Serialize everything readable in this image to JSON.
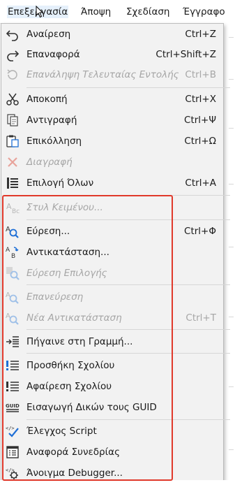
{
  "menubar": {
    "items": [
      {
        "label": "Επεξεργασία"
      },
      {
        "label": "Άποψη"
      },
      {
        "label": "Σχεδίαση"
      },
      {
        "label": "Έγγραφο"
      }
    ]
  },
  "menu": {
    "items": [
      {
        "label": "Αναίρεση",
        "shortcut": "Ctrl+Z",
        "icon": "undo-icon",
        "enabled": true
      },
      {
        "label": "Επαναφορά",
        "shortcut": "Ctrl+Shift+Z",
        "icon": "redo-icon",
        "enabled": true
      },
      {
        "label": "Επανάληψη Τελευταίας Εντολής",
        "shortcut": "Ctrl+B",
        "icon": "repeat-icon",
        "enabled": false
      },
      {
        "label": "Αποκοπή",
        "shortcut": "Ctrl+X",
        "icon": "scissors-icon",
        "enabled": true
      },
      {
        "label": "Αντιγραφή",
        "shortcut": "Ctrl+Ψ",
        "icon": "copy-icon",
        "enabled": true
      },
      {
        "label": "Επικόλληση",
        "shortcut": "Ctrl+Ω",
        "icon": "paste-icon",
        "enabled": true
      },
      {
        "label": "Διαγραφή",
        "shortcut": "",
        "icon": "delete-icon",
        "enabled": false
      },
      {
        "label": "Επιλογή Όλων",
        "shortcut": "Ctrl+A",
        "icon": "select-all-icon",
        "enabled": true
      },
      {
        "label": "Στυλ Κειμένου...",
        "shortcut": "",
        "icon": "text-style-icon",
        "enabled": false
      },
      {
        "label": "Εύρεση...",
        "shortcut": "Ctrl+Φ",
        "icon": "find-icon",
        "enabled": true
      },
      {
        "label": "Αντικατάσταση...",
        "shortcut": "",
        "icon": "replace-icon",
        "enabled": true
      },
      {
        "label": "Εύρεση Επιλογής",
        "shortcut": "",
        "icon": "find-selection-icon",
        "enabled": false
      },
      {
        "label": "Επανεύρεση",
        "shortcut": "",
        "icon": "find-again-icon",
        "enabled": false
      },
      {
        "label": "Νέα Αντικατάσταση",
        "shortcut": "Ctrl+T",
        "icon": "replace-again-icon",
        "enabled": false
      },
      {
        "label": "Πήγαινε στη Γραμμή...",
        "shortcut": "",
        "icon": "goto-line-icon",
        "enabled": true
      },
      {
        "label": "Προσθήκη Σχολίου",
        "shortcut": "",
        "icon": "add-comment-icon",
        "enabled": true
      },
      {
        "label": "Αφαίρεση Σχολίου",
        "shortcut": "",
        "icon": "remove-comment-icon",
        "enabled": true
      },
      {
        "label": "Εισαγωγή Δικών τους GUID",
        "shortcut": "",
        "icon": "guid-icon",
        "enabled": true
      },
      {
        "label": "Έλεγχος Script",
        "shortcut": "",
        "icon": "check-script-icon",
        "enabled": true
      },
      {
        "label": "Αναφορά Συνεδρίας",
        "shortcut": "",
        "icon": "session-report-icon",
        "enabled": true
      },
      {
        "label": "Άνοιγμα Debugger...",
        "shortcut": "",
        "icon": "debugger-icon",
        "enabled": true
      }
    ]
  },
  "colors": {
    "accent": "#1e6fd6",
    "highlight_box": "#e0392b",
    "disabled_text": "#a6a6a6"
  }
}
